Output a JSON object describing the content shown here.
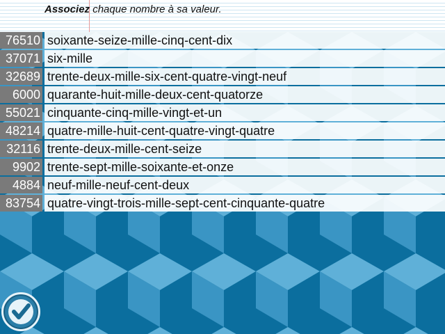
{
  "instruction": {
    "bold": "Associez",
    "rest": " chaque nombre à sa valeur."
  },
  "pairs": [
    {
      "number": "76510",
      "words": "soixante-seize-mille-cinq-cent-dix"
    },
    {
      "number": "37071",
      "words": "six-mille"
    },
    {
      "number": "32689",
      "words": "trente-deux-mille-six-cent-quatre-vingt-neuf"
    },
    {
      "number": "6000",
      "words": "quarante-huit-mille-deux-cent-quatorze"
    },
    {
      "number": "55021",
      "words": "cinquante-cinq-mille-vingt-et-un"
    },
    {
      "number": "48214",
      "words": "quatre-mille-huit-cent-quatre-vingt-quatre"
    },
    {
      "number": "32116",
      "words": "trente-deux-mille-cent-seize"
    },
    {
      "number": "9902",
      "words": "trente-sept-mille-soixante-et-onze"
    },
    {
      "number": "4884",
      "words": "neuf-mille-neuf-cent-deux"
    },
    {
      "number": "83754",
      "words": "quatre-vingt-trois-mille-sept-cent-cinquante-quatre"
    }
  ],
  "check_button": {
    "icon": "checkmark-icon"
  },
  "colors": {
    "background_dark": "#0b6e9e",
    "background_mid": "#3a95c4",
    "background_light": "#5fb0d8",
    "number_cell": "#7a7a7a",
    "word_cell": "#f2f2f2"
  }
}
